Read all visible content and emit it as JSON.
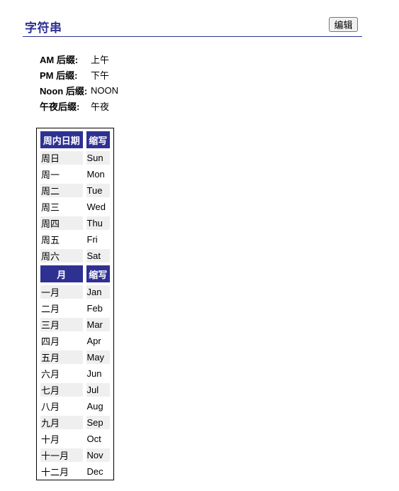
{
  "section": {
    "title": "字符串",
    "edit_label": "编辑"
  },
  "suffixes": [
    {
      "label": "AM 后缀:",
      "value": "上午"
    },
    {
      "label": "PM 后缀:",
      "value": "下午"
    },
    {
      "label": "Noon 后缀:",
      "value": "NOON"
    },
    {
      "label": "午夜后缀:",
      "value": "午夜"
    }
  ],
  "weekdays": {
    "header_name": "周内日期",
    "header_abbr": "缩写",
    "rows": [
      {
        "name": "周日",
        "abbr": "Sun"
      },
      {
        "name": "周一",
        "abbr": "Mon"
      },
      {
        "name": "周二",
        "abbr": "Tue"
      },
      {
        "name": "周三",
        "abbr": "Wed"
      },
      {
        "name": "周四",
        "abbr": "Thu"
      },
      {
        "name": "周五",
        "abbr": "Fri"
      },
      {
        "name": "周六",
        "abbr": "Sat"
      }
    ]
  },
  "months": {
    "header_name": "月",
    "header_abbr": "缩写",
    "rows": [
      {
        "name": "一月",
        "abbr": "Jan"
      },
      {
        "name": "二月",
        "abbr": "Feb"
      },
      {
        "name": "三月",
        "abbr": "Mar"
      },
      {
        "name": "四月",
        "abbr": "Apr"
      },
      {
        "name": "五月",
        "abbr": "May"
      },
      {
        "name": "六月",
        "abbr": "Jun"
      },
      {
        "name": "七月",
        "abbr": "Jul"
      },
      {
        "name": "八月",
        "abbr": "Aug"
      },
      {
        "name": "九月",
        "abbr": "Sep"
      },
      {
        "name": "十月",
        "abbr": "Oct"
      },
      {
        "name": "十一月",
        "abbr": "Nov"
      },
      {
        "name": "十二月",
        "abbr": "Dec"
      }
    ]
  },
  "colors": {
    "accent": "#2e3192",
    "row_alt": "#efefef"
  }
}
